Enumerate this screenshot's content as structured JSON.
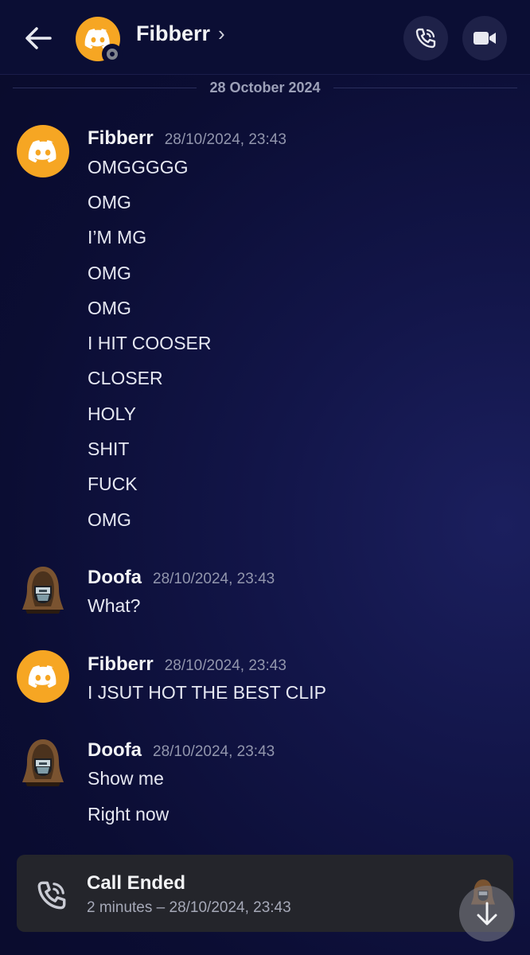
{
  "header": {
    "contact_name": "Fibberr",
    "chevron": "›"
  },
  "date_divider": "28 October 2024",
  "messages": [
    {
      "author": "Fibberr",
      "timestamp": "28/10/2024, 23:43",
      "avatar": "discord-logo-avatar",
      "lines": [
        "OMGGGGG",
        "OMG",
        "I’M MG",
        "OMG",
        "OMG",
        "I HIT COOSER",
        "CLOSER",
        "HOLY",
        "SHIT",
        "FUCK",
        "OMG"
      ]
    },
    {
      "author": "Doofa",
      "timestamp": "28/10/2024, 23:43",
      "avatar": "hooded-figure-avatar",
      "lines": [
        "What?"
      ]
    },
    {
      "author": "Fibberr",
      "timestamp": "28/10/2024, 23:43",
      "avatar": "discord-logo-avatar",
      "lines": [
        "I JSUT HOT THE BEST CLIP"
      ]
    },
    {
      "author": "Doofa",
      "timestamp": "28/10/2024, 23:43",
      "avatar": "hooded-figure-avatar",
      "lines": [
        "Show me",
        "Right now"
      ]
    }
  ],
  "call_card": {
    "title": "Call Ended",
    "subtitle": "2 minutes – 28/10/2024, 23:43"
  },
  "colors": {
    "accent_avatar": "#f6a623",
    "background": "#0b0d33",
    "card": "#24252b"
  }
}
